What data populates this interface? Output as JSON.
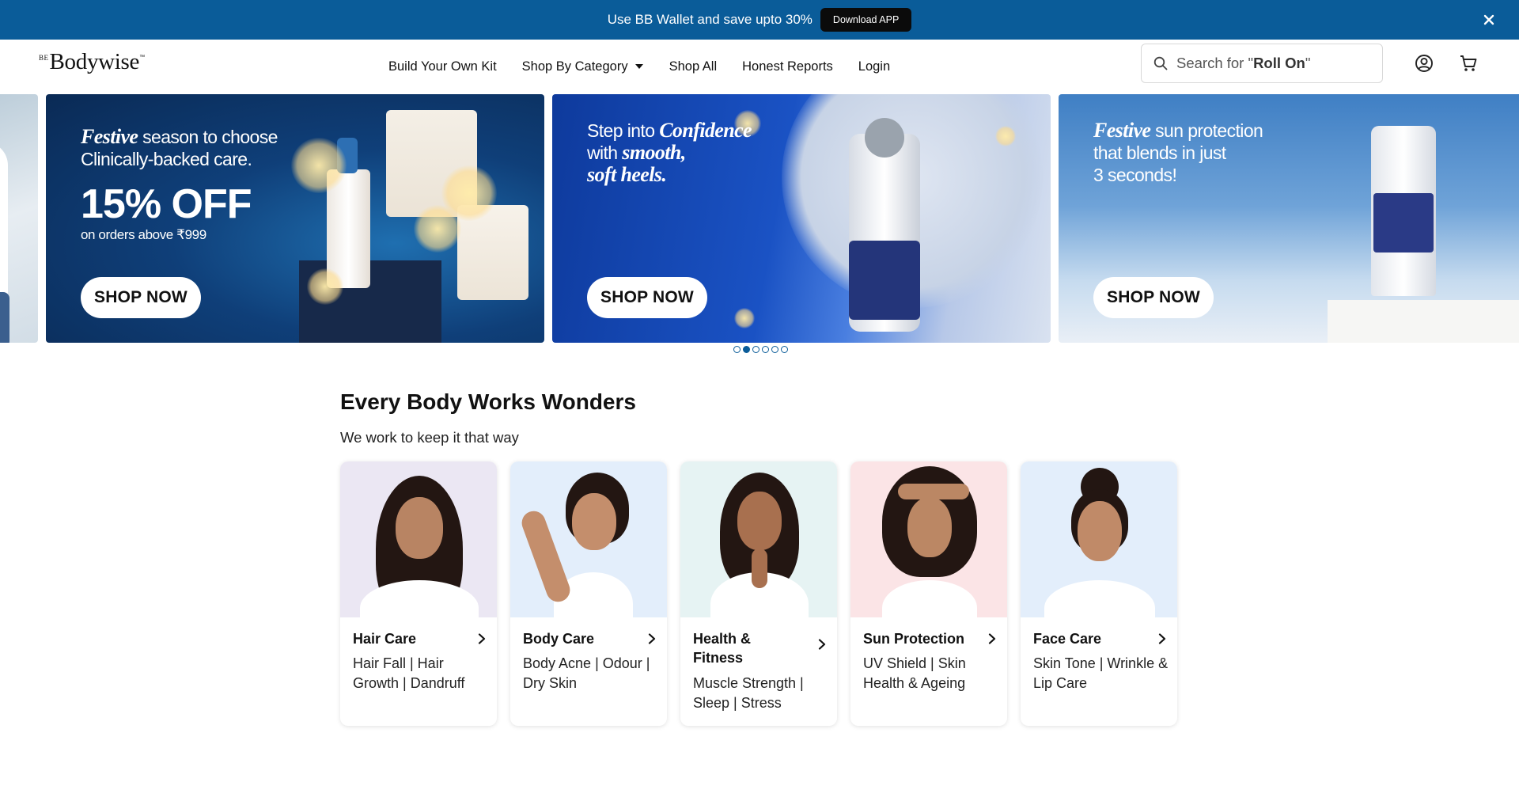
{
  "announcement": {
    "text": "Use BB Wallet and save upto 30%",
    "button_label": "Download APP",
    "close_icon": "close-icon"
  },
  "header": {
    "logo": {
      "prefix": "BE",
      "name": "Bodywise",
      "suffix": "™"
    },
    "nav": [
      {
        "label": "Build Your Own Kit"
      },
      {
        "label": "Shop By Category",
        "has_dropdown": true
      },
      {
        "label": "Shop All"
      },
      {
        "label": "Honest Reports"
      },
      {
        "label": "Login"
      }
    ],
    "search": {
      "prefix": "Search for \"",
      "term": "Roll On",
      "suffix": "\"",
      "icon": "search-icon"
    },
    "account_icon": "account-icon",
    "cart_icon": "cart-icon"
  },
  "carousel": {
    "slides": [
      {
        "lines": [
          {
            "emph": "Festive",
            "rest": " season to choose"
          },
          {
            "emph": "",
            "rest": "Clinically-backed care."
          }
        ],
        "big": "15% OFF",
        "small": "on orders above ₹999",
        "button_label": "SHOP NOW"
      },
      {
        "lines": [
          {
            "emph": "",
            "rest": "Step into ",
            "emph2": "Confidence"
          },
          {
            "emph": "",
            "rest": "with ",
            "emph2": "smooth,"
          },
          {
            "emph": "soft heels.",
            "rest": ""
          }
        ],
        "button_label": "SHOP NOW"
      },
      {
        "lines": [
          {
            "emph": "Festive",
            "rest": " sun protection"
          },
          {
            "emph": "",
            "rest": "that blends in just"
          },
          {
            "emph": "",
            "rest": "3 seconds!"
          }
        ],
        "button_label": "SHOP NOW"
      }
    ],
    "dot_count": 6,
    "active_dot": 1
  },
  "section": {
    "title": "Every Body Works Wonders",
    "subtitle": "We work to keep it that way"
  },
  "categories": [
    {
      "title": "Hair Care",
      "desc": "Hair Fall | Hair Growth | Dandruff",
      "bg": "#ebe7f3"
    },
    {
      "title": "Body Care",
      "desc": "Body Acne | Odour | Dry Skin",
      "bg": "#e3eefb"
    },
    {
      "title": "Health & Fitness",
      "desc": "Muscle Strength | Sleep | Stress",
      "bg": "#e6f3f3"
    },
    {
      "title": "Sun Protection",
      "desc": "UV Shield | Skin Health & Ageing",
      "bg": "#fbe4e6"
    },
    {
      "title": "Face Care",
      "desc": "Skin Tone | Wrinkle & Lip Care",
      "bg": "#e3eefb"
    }
  ],
  "colors": {
    "accent": "#0a5c99",
    "button_dark": "#0b0b0b"
  }
}
